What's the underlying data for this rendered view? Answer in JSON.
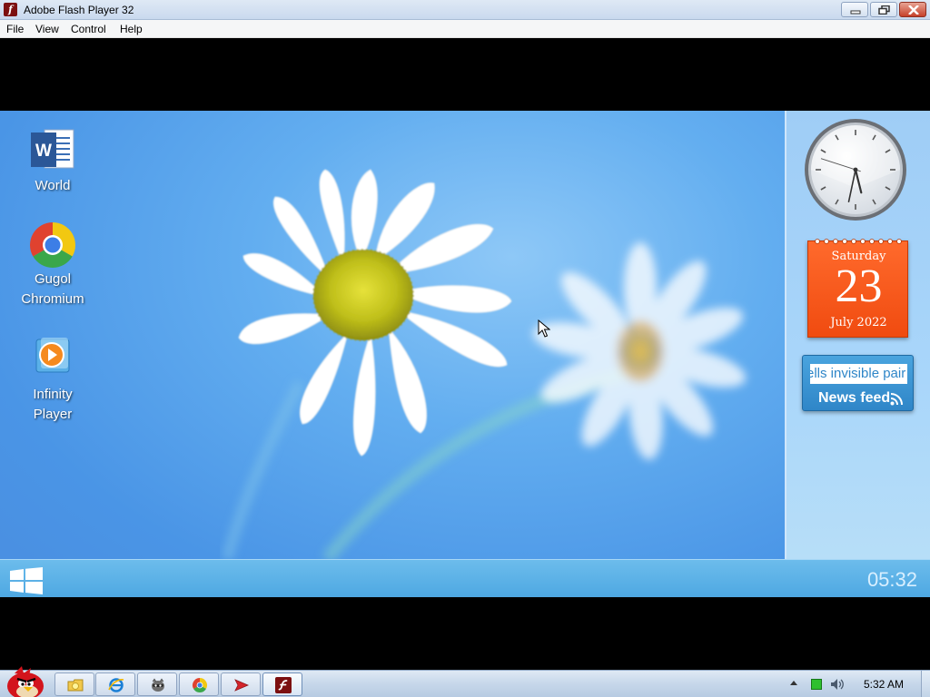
{
  "window": {
    "title": "Adobe Flash Player 32",
    "icon": "flash-icon"
  },
  "menu": {
    "items": [
      {
        "label": "File"
      },
      {
        "label": "View"
      },
      {
        "label": "Control"
      },
      {
        "label": "Help"
      }
    ]
  },
  "desktop": {
    "icons": [
      {
        "label": "World",
        "icon": "word-icon"
      },
      {
        "label": "Gugol\nChromium",
        "line1": "Gugol",
        "line2": "Chromium",
        "icon": "chromium-icon"
      },
      {
        "label": "Infinity\nPlayer",
        "line1": "Infinity",
        "line2": "Player",
        "icon": "media-player-icon"
      }
    ],
    "clock_time": "05:32"
  },
  "gadgets": {
    "clock": {
      "hours": 5,
      "minutes": 32,
      "seconds": 48
    },
    "calendar": {
      "weekday": "Saturday",
      "day": "23",
      "month_year": "July 2022"
    },
    "newsfeed": {
      "ticker": "ells invisible pair",
      "label": "News feed"
    }
  },
  "host_taskbar": {
    "buttons": [
      {
        "icon": "angry-bird-start-icon"
      },
      {
        "icon": "explorer-icon"
      },
      {
        "icon": "internet-explorer-icon"
      },
      {
        "icon": "raccoon-app-icon"
      },
      {
        "icon": "chrome-icon"
      },
      {
        "icon": "red-arrow-app-icon"
      },
      {
        "icon": "flash-player-icon"
      }
    ],
    "tray_time": "5:32 AM"
  },
  "colors": {
    "desktop_blue": "#4a95e6",
    "calendar_orange": "#f04b10",
    "news_blue": "#2f86c8"
  }
}
